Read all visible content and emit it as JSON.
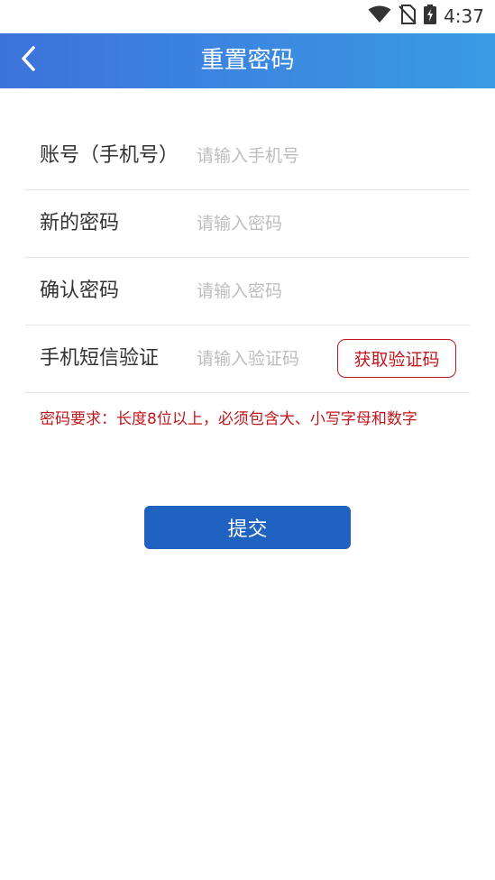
{
  "status_bar": {
    "time": "4:37",
    "icons": [
      "wifi-icon",
      "no-sim-icon",
      "battery-charging-icon"
    ]
  },
  "header": {
    "title": "重置密码",
    "back_icon": "chevron-left-icon",
    "gradient_start": "#3c73db",
    "gradient_end": "#3a9be4"
  },
  "form": {
    "account": {
      "label": "账号（手机号）",
      "placeholder": "请输入手机号",
      "value": ""
    },
    "new_password": {
      "label": "新的密码",
      "placeholder": "请输入密码",
      "value": ""
    },
    "confirm_password": {
      "label": "确认密码",
      "placeholder": "请输入密码",
      "value": ""
    },
    "sms_code": {
      "label": "手机短信验证",
      "placeholder": "请输入验证码",
      "value": "",
      "get_code_label": "获取验证码"
    }
  },
  "hint": "密码要求：长度8位以上，必须包含大、小写字母和数字",
  "submit_label": "提交",
  "colors": {
    "accent_red": "#c0161d",
    "button_blue": "#2062c0",
    "placeholder_gray": "#bdbdbd"
  }
}
